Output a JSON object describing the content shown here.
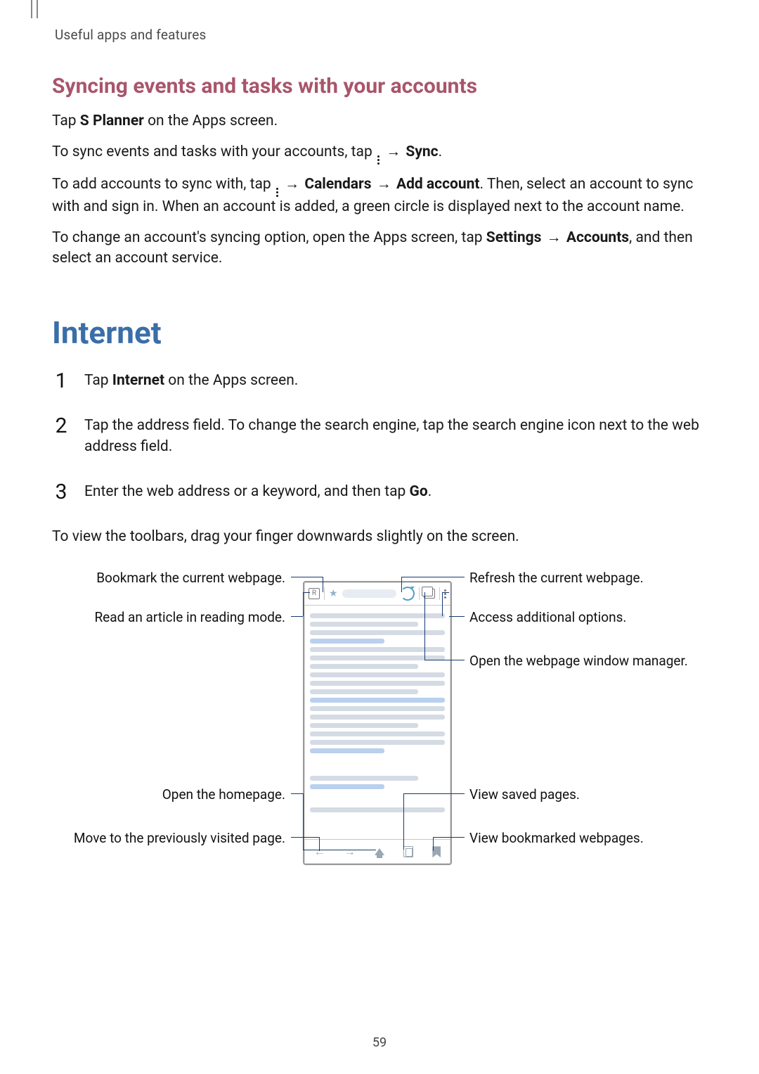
{
  "header": {
    "crumb": "Useful apps and features"
  },
  "sync": {
    "title": "Syncing events and tasks with your accounts",
    "p1_a": "Tap ",
    "p1_b": "S Planner",
    "p1_c": " on the Apps screen.",
    "p2_a": "To sync events and tasks with your accounts, tap ",
    "p2_b": "Sync",
    "p2_c": ".",
    "p3_a": "To add accounts to sync with, tap ",
    "p3_b": "Calendars",
    "p3_c": "Add account",
    "p3_d": ". Then, select an account to sync with and sign in. When an account is added, a green circle is displayed next to the account name.",
    "p4_a": "To change an account's syncing option, open the Apps screen, tap ",
    "p4_b": "Settings",
    "p4_c": "Accounts",
    "p4_d": ", and then select an account service."
  },
  "internet": {
    "title": "Internet",
    "steps": [
      {
        "num": "1",
        "pre": "Tap ",
        "bold": "Internet",
        "post": " on the Apps screen."
      },
      {
        "num": "2",
        "text": "Tap the address field. To change the search engine, tap the search engine icon next to the web address field."
      },
      {
        "num": "3",
        "pre": "Enter the web address or a keyword, and then tap ",
        "bold": "Go",
        "post": "."
      }
    ],
    "toolbars_note": "To view the toolbars, drag your finger downwards slightly on the screen."
  },
  "callouts": {
    "bookmark": "Bookmark the current webpage.",
    "reader": "Read an article in reading mode.",
    "homepage": "Open the homepage.",
    "prevpage": "Move to the previously visited page.",
    "refresh": "Refresh the current webpage.",
    "options": "Access additional options.",
    "windows": "Open the webpage window manager.",
    "saved": "View saved pages.",
    "bookmarks": "View bookmarked webpages."
  },
  "arrow": "→",
  "page_number": "59"
}
